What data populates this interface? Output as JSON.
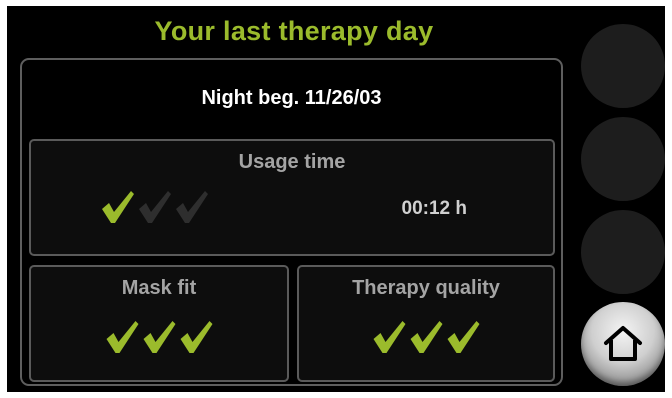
{
  "screen": {
    "title": "Your last therapy day",
    "night_label": "Night beg. 11/26/03"
  },
  "usage": {
    "label": "Usage time",
    "value": "00:12 h",
    "rating": 1,
    "max_rating": 3
  },
  "mask_fit": {
    "label": "Mask fit",
    "rating": 3,
    "max_rating": 3
  },
  "therapy_quality": {
    "label": "Therapy quality",
    "rating": 3,
    "max_rating": 3
  },
  "side_buttons": [
    {
      "icon": "blank-button"
    },
    {
      "icon": "blank-button"
    },
    {
      "icon": "blank-button"
    },
    {
      "icon": "home-icon"
    }
  ],
  "colors": {
    "background": "#000000",
    "title": "#9bbb2c",
    "check_on": "#9bbb2c",
    "check_off": "#2e2e2e",
    "frame": "#5e5e5e"
  }
}
